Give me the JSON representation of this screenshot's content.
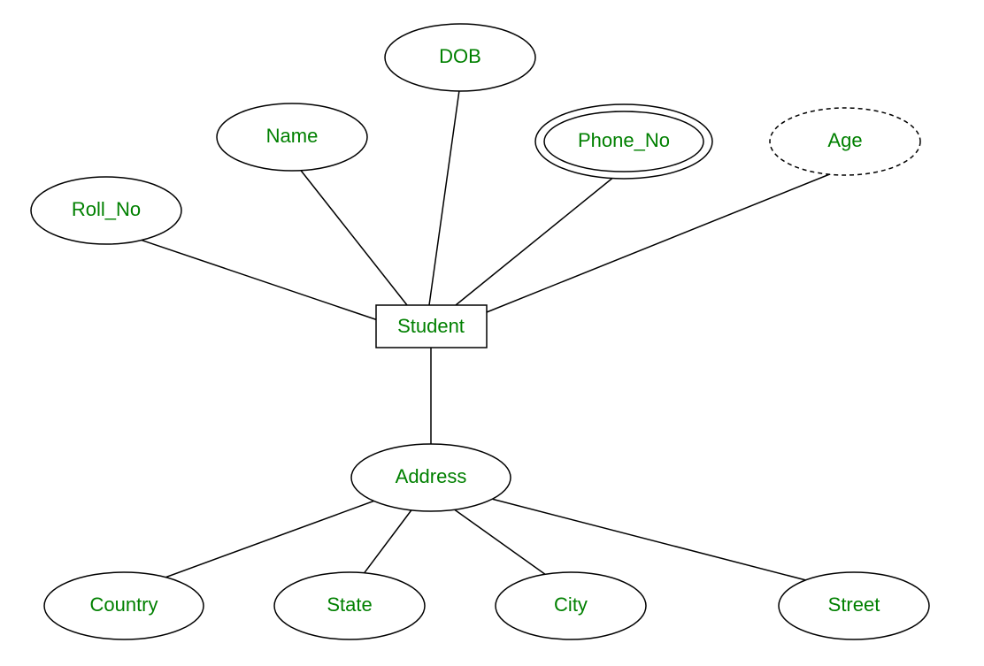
{
  "diagram": {
    "type": "er-diagram",
    "entity": {
      "name": "Student"
    },
    "attributes": {
      "roll_no": {
        "label": "Roll_No",
        "kind": "simple"
      },
      "name": {
        "label": "Name",
        "kind": "simple"
      },
      "dob": {
        "label": "DOB",
        "kind": "simple"
      },
      "phone_no": {
        "label": "Phone_No",
        "kind": "multivalued"
      },
      "age": {
        "label": "Age",
        "kind": "derived"
      },
      "address": {
        "label": "Address",
        "kind": "composite"
      }
    },
    "address_components": {
      "country": {
        "label": "Country"
      },
      "state": {
        "label": "State"
      },
      "city": {
        "label": "City"
      },
      "street": {
        "label": "Street"
      }
    }
  },
  "colors": {
    "label": "#008000",
    "stroke": "#000000",
    "background": "#ffffff"
  }
}
